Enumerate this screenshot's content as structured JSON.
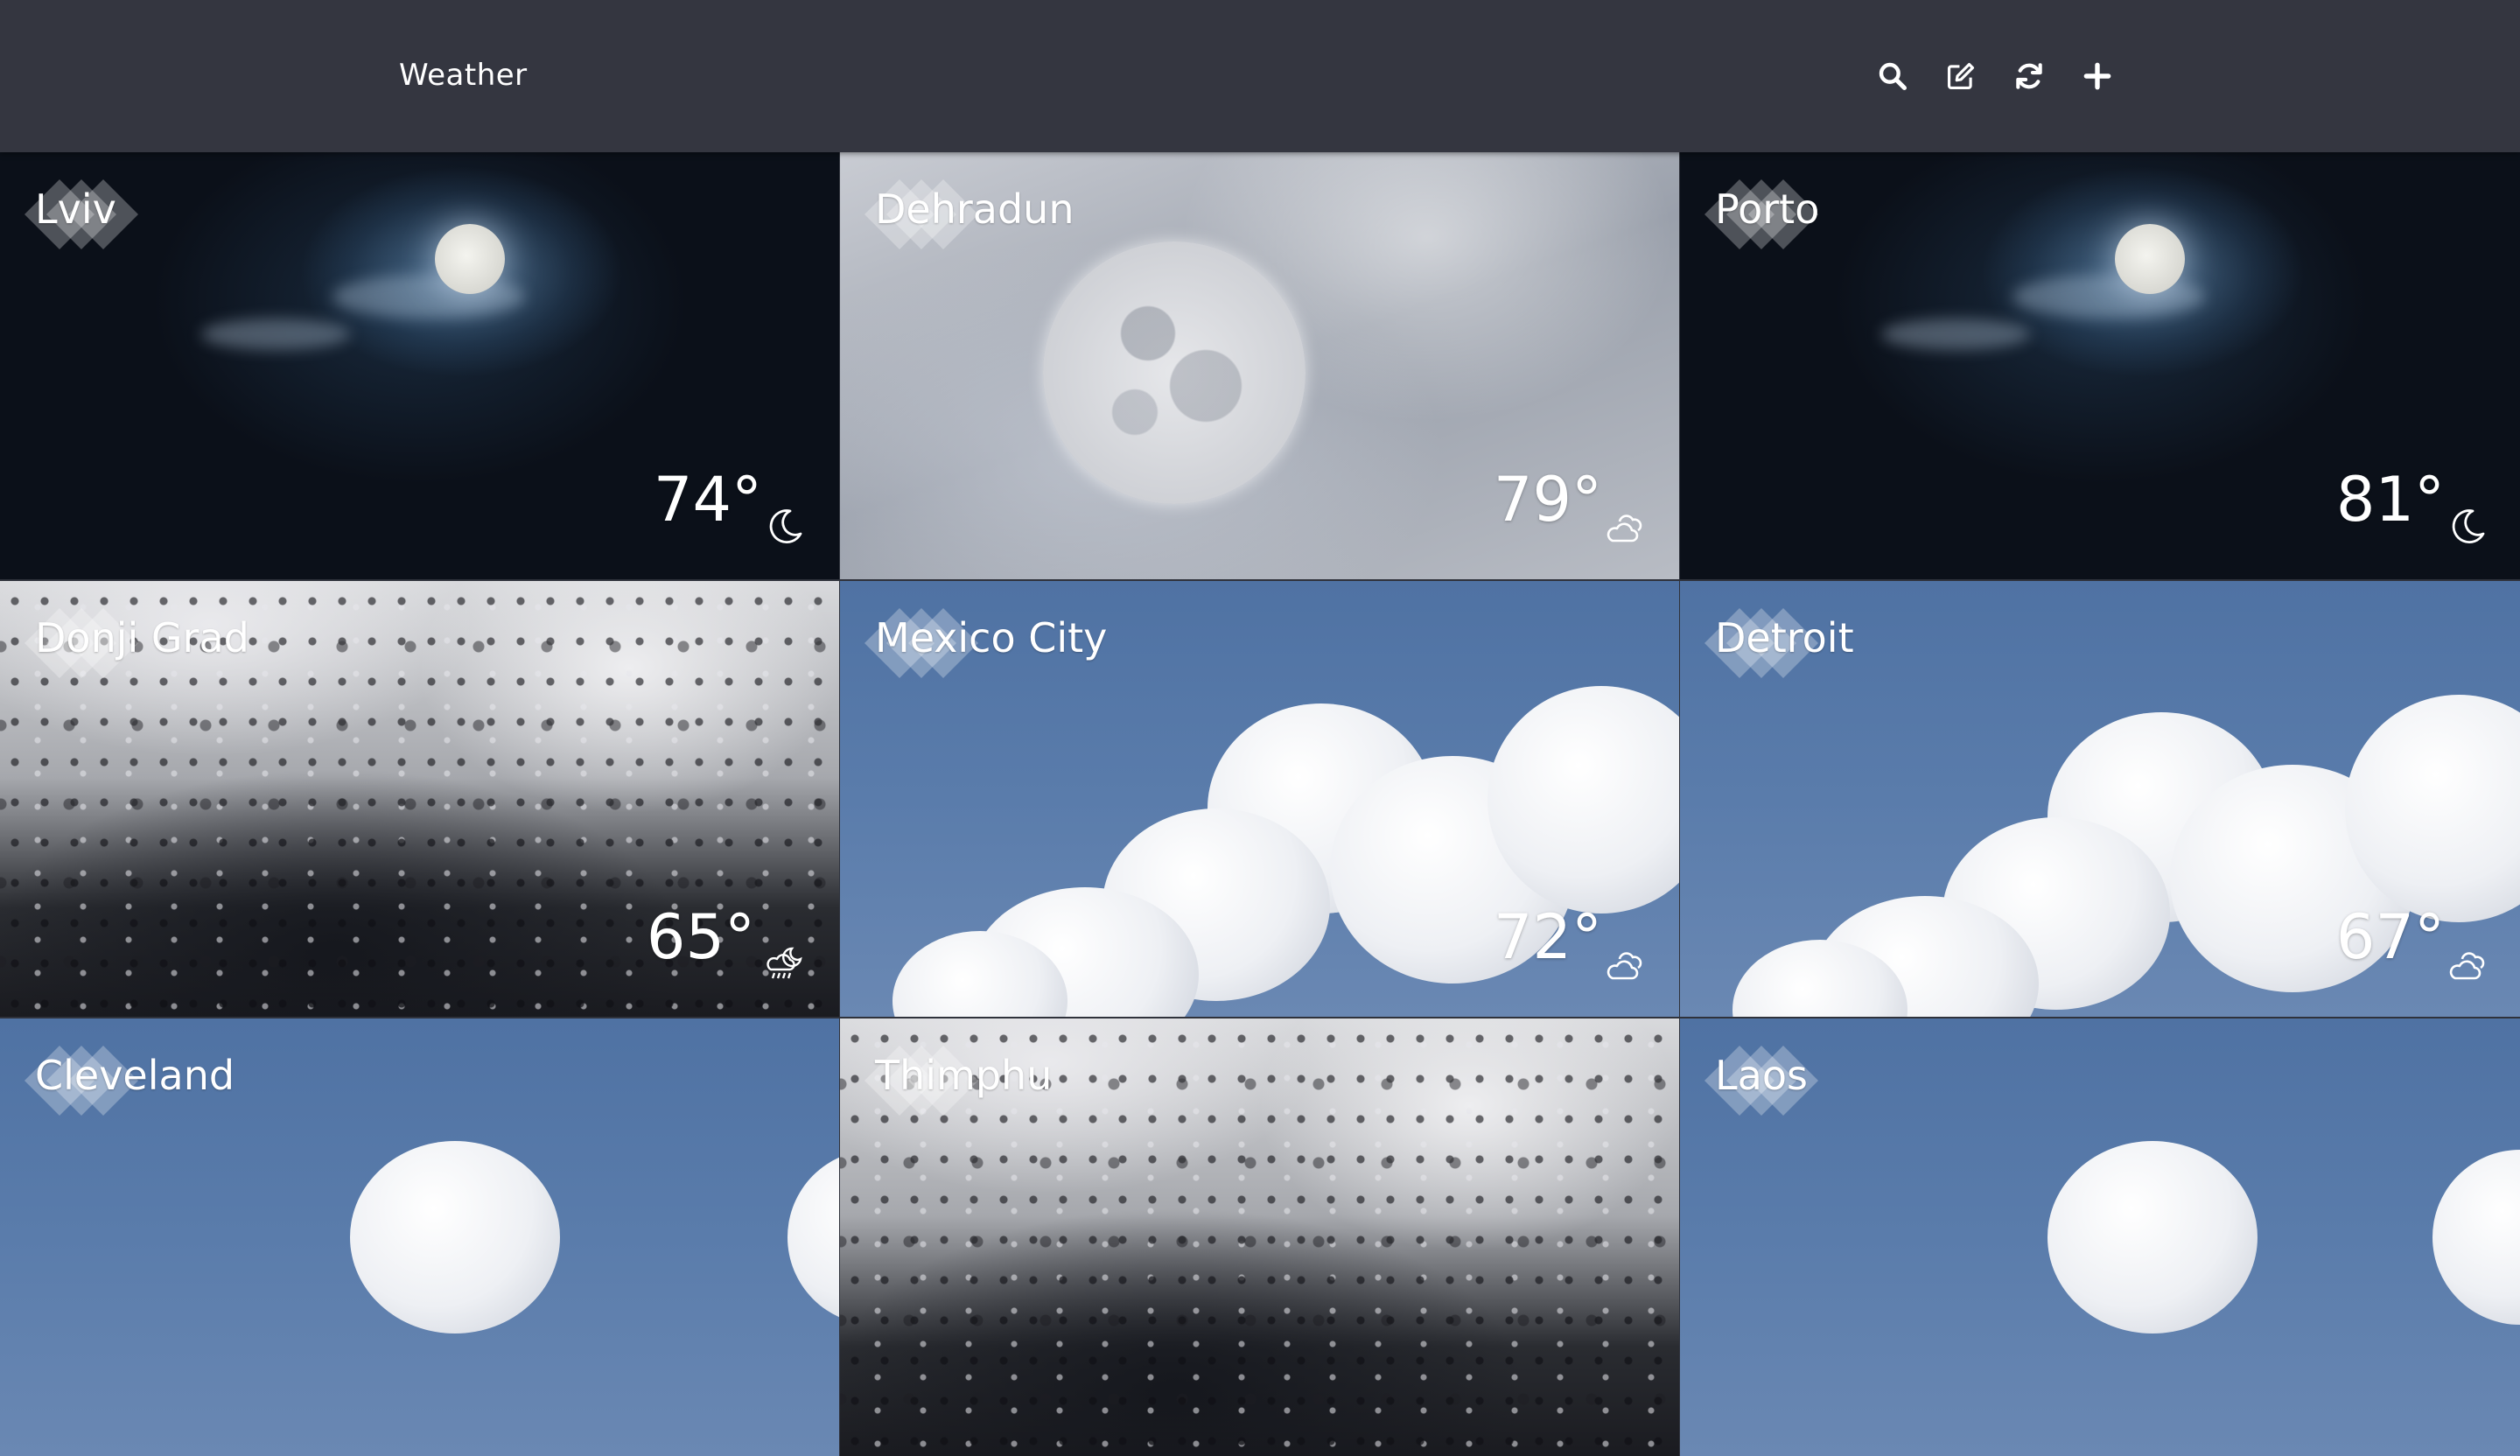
{
  "header": {
    "title": "Weather",
    "toolbar": [
      {
        "name": "search-button",
        "icon": "search-icon"
      },
      {
        "name": "edit-button",
        "icon": "edit-icon"
      },
      {
        "name": "refresh-button",
        "icon": "refresh-icon"
      },
      {
        "name": "add-button",
        "icon": "plus-icon"
      }
    ]
  },
  "cities": [
    {
      "name": "Lviv",
      "temp": "74°",
      "condition_icon": "moon-icon",
      "background": "night-sky"
    },
    {
      "name": "Dehradun",
      "temp": "79°",
      "condition_icon": "cloud-icon",
      "background": "hazy-moon"
    },
    {
      "name": "Porto",
      "temp": "81°",
      "condition_icon": "moon-icon",
      "background": "night-sky"
    },
    {
      "name": "Donji Grad",
      "temp": "65°",
      "condition_icon": "night-rain-icon",
      "background": "rain-on-glass"
    },
    {
      "name": "Mexico City",
      "temp": "72°",
      "condition_icon": "cloud-icon",
      "background": "cumulus-sky"
    },
    {
      "name": "Detroit",
      "temp": "67°",
      "condition_icon": "cloud-icon",
      "background": "cumulus-sky"
    },
    {
      "name": "Cleveland",
      "temp": "",
      "condition_icon": "",
      "background": "cumulus-sky"
    },
    {
      "name": "Thimphu",
      "temp": "",
      "condition_icon": "",
      "background": "rain-on-glass"
    },
    {
      "name": "Laos",
      "temp": "",
      "condition_icon": "",
      "background": "cumulus-sky"
    }
  ],
  "colors": {
    "header_bg": "#343640",
    "text": "#ffffff",
    "sky_blue": "#5a7cab",
    "night": "#0b1019"
  }
}
